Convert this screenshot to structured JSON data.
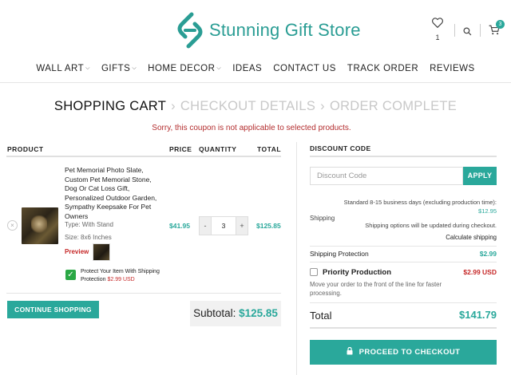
{
  "brand": {
    "name": "Stunning Gift Store",
    "accent": "#2aa89b"
  },
  "header": {
    "wishlist_count": "1",
    "cart_count": "3"
  },
  "nav": [
    {
      "label": "WALL ART",
      "dropdown": true
    },
    {
      "label": "GIFTS",
      "dropdown": true
    },
    {
      "label": "HOME DECOR",
      "dropdown": true
    },
    {
      "label": "IDEAS",
      "dropdown": false
    },
    {
      "label": "CONTACT US",
      "dropdown": false
    },
    {
      "label": "TRACK ORDER",
      "dropdown": false
    },
    {
      "label": "REVIEWS",
      "dropdown": false
    }
  ],
  "steps": {
    "current": "SHOPPING CART",
    "next1": "CHECKOUT DETAILS",
    "next2": "ORDER COMPLETE"
  },
  "notice": "Sorry, this coupon is not applicable to selected products.",
  "cart": {
    "headers": {
      "product": "PRODUCT",
      "price": "PRICE",
      "quantity": "QUANTITY",
      "total": "TOTAL"
    },
    "item": {
      "name": "Pet Memorial Photo Slate, Custom Pet Memorial Stone, Dog Or Cat Loss Gift, Personalized Outdoor Garden, Sympathy Keepsake For Pet Owners",
      "type": "Type: With Stand",
      "size": "Size: 8x6 Inches",
      "preview_label": "Preview",
      "protect_label": "Protect Your Item With Shipping Protection",
      "protect_price": "$2.99 USD",
      "price": "$41.95",
      "quantity": "3",
      "minus": "-",
      "plus": "+",
      "total": "$125.85"
    },
    "continue_label": "CONTINUE SHOPPING",
    "subtotal_label": "Subtotal:",
    "subtotal_value": "$125.85"
  },
  "summary": {
    "discount_title": "DISCOUNT CODE",
    "coupon_placeholder": "Discount Code",
    "apply_label": "APPLY",
    "shipping_label": "Shipping",
    "shipping_standard": "Standard 8-15 business days (excluding production time):",
    "shipping_standard_price": "$12.95",
    "shipping_note": "Shipping options will be updated during checkout.",
    "calculate_label": "Calculate shipping",
    "protection_label": "Shipping Protection",
    "protection_value": "$2.99",
    "priority_label": "Priority Production",
    "priority_value": "$2.99 USD",
    "priority_desc": "Move your order to the front of the line for faster processing.",
    "total_label": "Total",
    "total_value": "$141.79",
    "checkout_label": "PROCEED TO CHECKOUT"
  }
}
